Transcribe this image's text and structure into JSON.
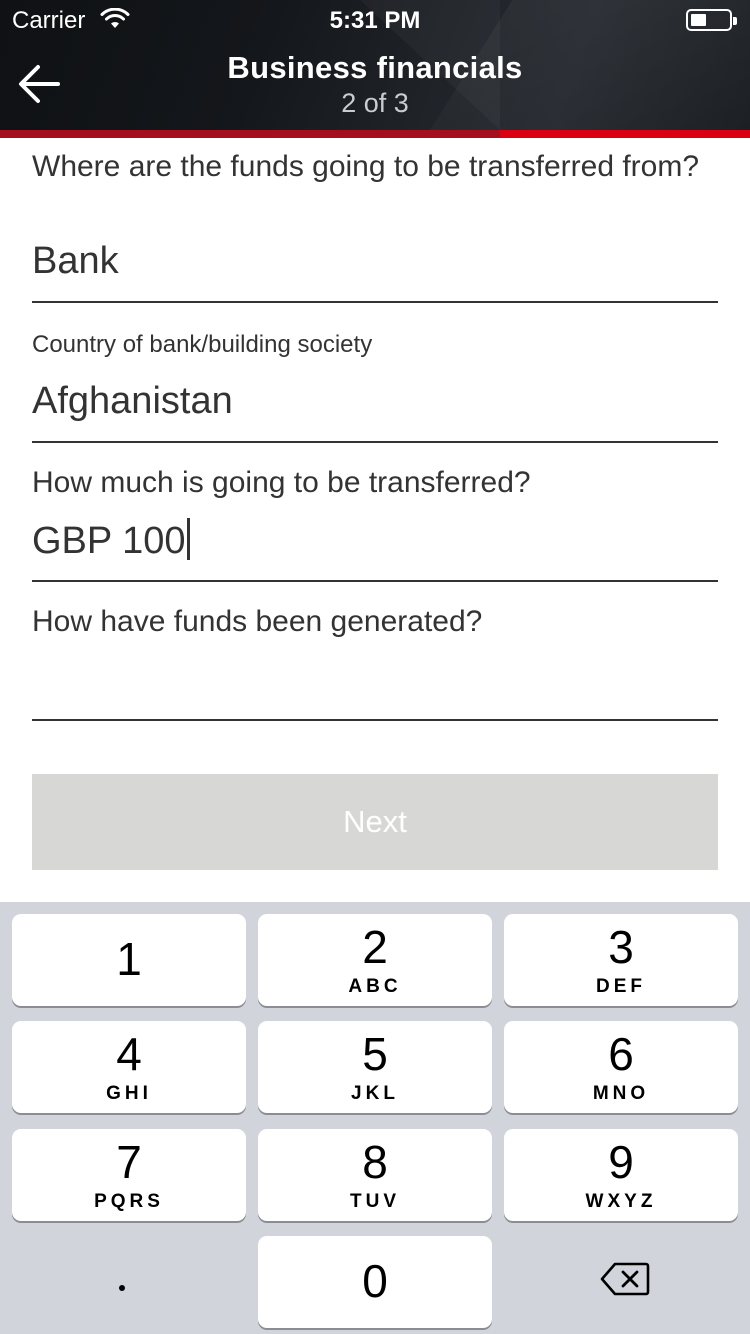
{
  "status_bar": {
    "carrier": "Carrier",
    "time": "5:31 PM",
    "wifi_icon": "wifi-icon",
    "battery_icon": "battery-icon"
  },
  "header": {
    "title": "Business financials",
    "subtitle": "2 of 3",
    "back_icon": "arrow-left-icon"
  },
  "progress": {
    "step": 2,
    "total": 3
  },
  "form": {
    "source_label": "Where are the funds going to be transferred from?",
    "source_value": "Bank",
    "country_label": "Country of bank/building society",
    "country_value": "Afghanistan",
    "amount_label": "How much is going to be transferred?",
    "amount_value": "GBP 100",
    "generated_label": "How have funds been generated?",
    "generated_value": ""
  },
  "next_button": {
    "label": "Next"
  },
  "keypad": {
    "keys": [
      {
        "num": "1",
        "letters": ""
      },
      {
        "num": "2",
        "letters": "ABC"
      },
      {
        "num": "3",
        "letters": "DEF"
      },
      {
        "num": "4",
        "letters": "GHI"
      },
      {
        "num": "5",
        "letters": "JKL"
      },
      {
        "num": "6",
        "letters": "MNO"
      },
      {
        "num": "7",
        "letters": "PQRS"
      },
      {
        "num": "8",
        "letters": "TUV"
      },
      {
        "num": "9",
        "letters": "WXYZ"
      },
      {
        "num": "0",
        "letters": ""
      }
    ],
    "decimal": ".",
    "backspace_icon": "backspace-icon"
  },
  "colors": {
    "brand_red": "#db0011",
    "header_dark": "#14171b",
    "disabled_button": "#d7d8d6",
    "keypad_bg": "#d1d5db"
  }
}
